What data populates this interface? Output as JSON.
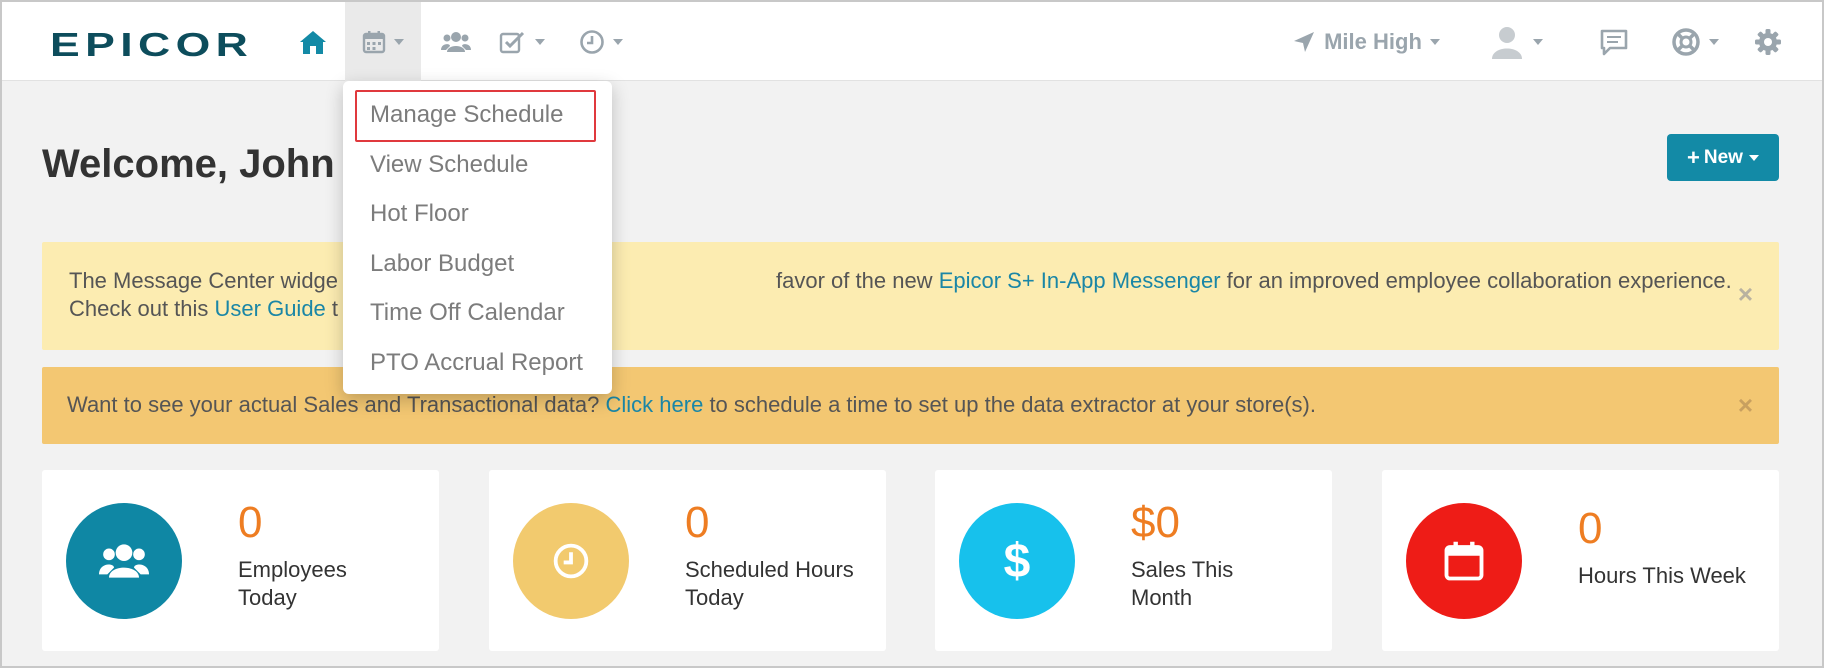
{
  "brand": {
    "logo_text": "EPICOR"
  },
  "nav": {
    "location": "Mile High",
    "accent_color": "#138aa6"
  },
  "schedule_menu": {
    "items": [
      {
        "label": "Manage Schedule",
        "highlighted": true
      },
      {
        "label": "View Schedule"
      },
      {
        "label": "Hot Floor"
      },
      {
        "label": "Labor Budget"
      },
      {
        "label": "Time Off Calendar"
      },
      {
        "label": "PTO Accrual Report"
      }
    ]
  },
  "main": {
    "welcome": "Welcome, John I",
    "new_button": "New"
  },
  "alerts": {
    "message_center": {
      "text_a": "The Message Center widge",
      "text_b": "favor of the new ",
      "link_1": "Epicor S+ In-App Messenger",
      "text_c": " for an improved employee collaboration experience.",
      "text_d": "Check out this ",
      "link_2": "User Guide",
      "text_e": " t"
    },
    "data_extractor": {
      "text_a": "Want to see your actual Sales and Transactional data? ",
      "link": "Click here",
      "text_b": " to schedule a time to set up the data extractor at your store(s)."
    },
    "close_glyph": "×"
  },
  "stats": [
    {
      "value": "0",
      "label": "Employees Today",
      "icon": "users-icon",
      "color": "#0f87a4"
    },
    {
      "value": "0",
      "label": "Scheduled Hours Today",
      "icon": "clock-icon",
      "color": "#f2ca6e"
    },
    {
      "value": "$0",
      "label": "Sales This Month",
      "icon": "dollar-icon",
      "color": "#17c1ec"
    },
    {
      "value": "0",
      "label": "Hours This Week",
      "icon": "calendar-icon",
      "color": "#ee1c17"
    }
  ]
}
